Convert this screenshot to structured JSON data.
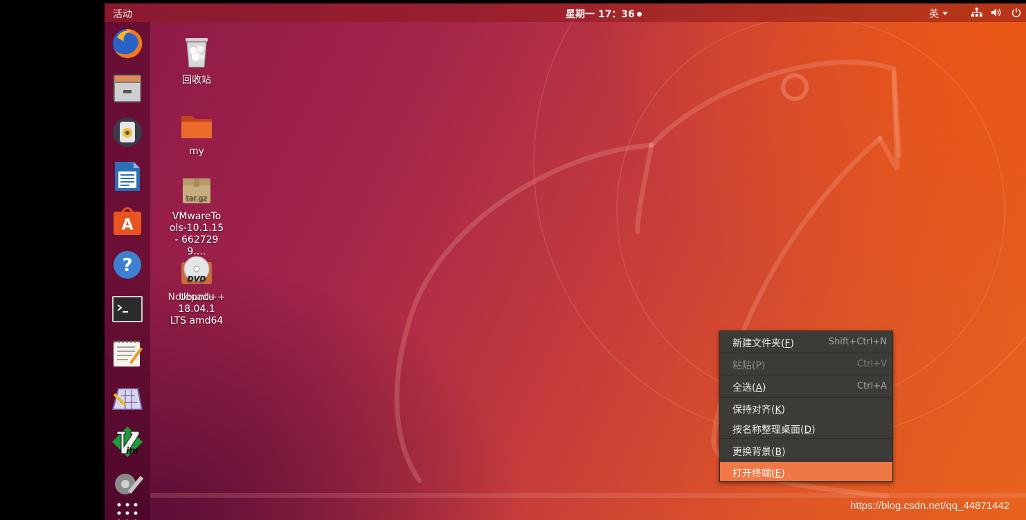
{
  "topbar": {
    "activities": "活动",
    "clock": "星期一 17：36",
    "input_method": "英",
    "icons": [
      "network-icon",
      "volume-icon",
      "power-icon"
    ]
  },
  "dock": {
    "items": [
      {
        "name": "firefox-icon",
        "interactable": true
      },
      {
        "name": "files-icon",
        "interactable": true
      },
      {
        "name": "rhythmbox-icon",
        "interactable": true
      },
      {
        "name": "libreoffice-writer-icon",
        "interactable": true
      },
      {
        "name": "software-center-icon",
        "interactable": true
      },
      {
        "name": "help-icon",
        "interactable": true
      },
      {
        "name": "terminal-icon",
        "interactable": true
      },
      {
        "name": "text-editor-icon",
        "interactable": true
      },
      {
        "name": "sudoku-icon",
        "interactable": true
      },
      {
        "name": "vim-icon",
        "interactable": true
      },
      {
        "name": "settings-icon",
        "interactable": true
      },
      {
        "name": "show-apps-icon",
        "interactable": true
      }
    ]
  },
  "desktop": {
    "icons": [
      {
        "label": "回收站",
        "icon": "trash-icon"
      },
      {
        "label": "my",
        "icon": "folder-icon"
      },
      {
        "label": "VMwareTo ols-10.1.15- 6627299.…",
        "icon": "archive-icon",
        "badge": "tar.gz"
      },
      {
        "label": "Ubuntu 18.04.1 LTS amd64",
        "overlay_label": "Notepad++",
        "icon": "dvd-icon",
        "badge": "DVD"
      }
    ]
  },
  "context_menu": {
    "items": [
      {
        "label_main": "新建文件夹(",
        "mnemonic": "F",
        "label_end": ")",
        "accel": "Shift+Ctrl+N",
        "disabled": false,
        "highlighted": false
      },
      {
        "label_main": "粘贴(P)",
        "mnemonic": "",
        "label_end": "",
        "accel": "Ctrl+V",
        "disabled": true,
        "highlighted": false
      },
      {
        "label_main": "全选(",
        "mnemonic": "A",
        "label_end": ")",
        "accel": "Ctrl+A",
        "disabled": false,
        "highlighted": false
      },
      {
        "label_main": "保持对齐(",
        "mnemonic": "K",
        "label_end": ")",
        "accel": "",
        "disabled": false,
        "highlighted": false
      },
      {
        "label_main": "按名称整理桌面(",
        "mnemonic": "D",
        "label_end": ")",
        "accel": "",
        "disabled": false,
        "highlighted": false
      },
      {
        "label_main": "更换背景(",
        "mnemonic": "B",
        "label_end": ")",
        "accel": "",
        "disabled": false,
        "highlighted": false
      },
      {
        "label_main": "打开终端(",
        "mnemonic": "E",
        "label_end": ")",
        "accel": "",
        "disabled": false,
        "highlighted": true
      }
    ]
  },
  "watermark": "https://blog.csdn.net/qq_44871442",
  "colors": {
    "menu_bg": "#3c3b37",
    "menu_highlight": "#f07746",
    "wallpaper_orange": "#e8631c",
    "wallpaper_purple": "#8a1848"
  }
}
